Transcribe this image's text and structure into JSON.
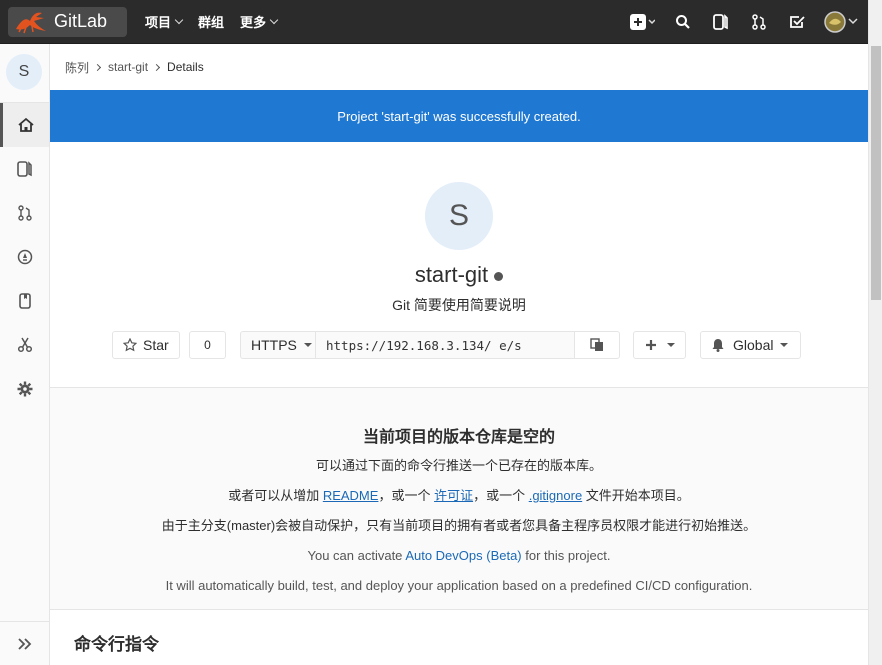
{
  "topbar": {
    "brand": "GitLab",
    "menu": [
      "项目",
      "群组",
      "更多"
    ]
  },
  "sidebar": {
    "avatar_letter": "S"
  },
  "breadcrumb": {
    "parent": "陈列",
    "project": "start-git",
    "current": "Details"
  },
  "flash": "Project 'start-git' was successfully created.",
  "project": {
    "avatar_letter": "S",
    "name": "start-git",
    "description": "Git 简要使用简要说明"
  },
  "actions": {
    "star_label": "Star",
    "star_count": "0",
    "protocol": "HTTPS",
    "clone_url": "https://192.168.3.134/        e/s",
    "notify_label": "Global"
  },
  "empty_repo": {
    "title": "当前项目的版本仓库是空的",
    "line1": "可以通过下面的命令行推送一个已存在的版本库。",
    "line2_a": "或者可以从增加 ",
    "readme": "README",
    "line2_b": "，或一个 ",
    "license": "许可证",
    "line2_c": "，或一个 ",
    "gitignore": ".gitignore",
    "line2_d": " 文件开始本项目。",
    "line3": "由于主分支(master)会被自动保护，只有当前项目的拥有者或者您具备主程序员权限才能进行初始推送。",
    "devops_a": "You can activate ",
    "devops_link": "Auto DevOps (Beta)",
    "devops_b": " for this project.",
    "line5": "It will automatically build, test, and deploy your application based on a predefined CI/CD configuration."
  },
  "cmd_title": "命令行指令",
  "colors": {
    "navbar": "#2b2b2b",
    "flash": "#1f78d1",
    "link": "#1b69b6",
    "avatar_bg": "#e3eef9"
  }
}
